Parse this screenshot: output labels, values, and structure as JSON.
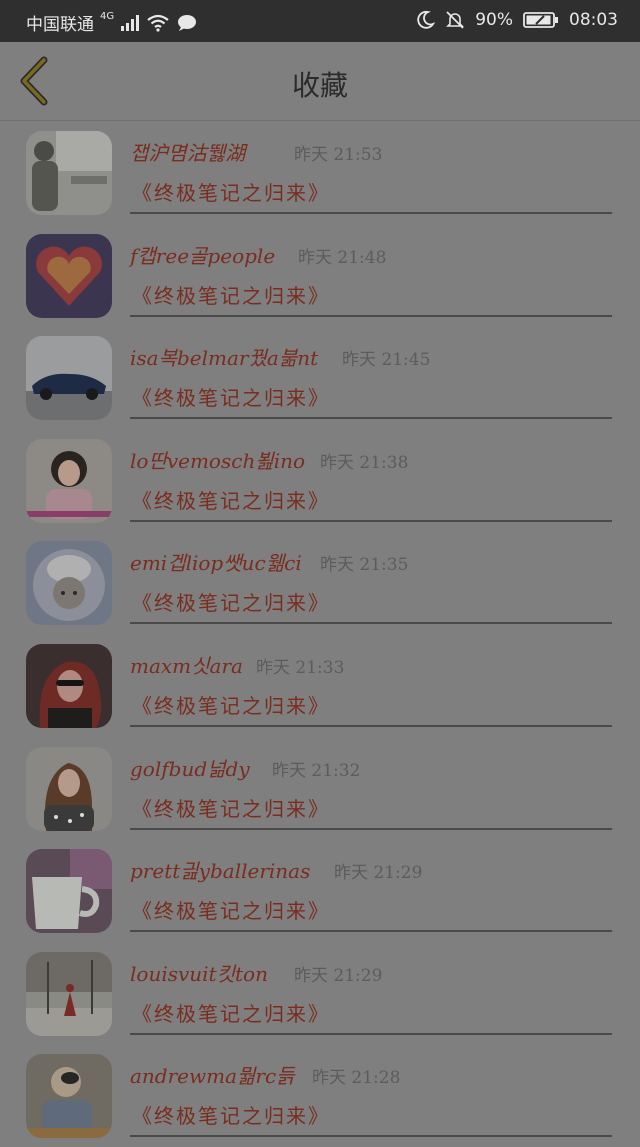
{
  "status_bar": {
    "carrier": "中国联通",
    "network": "4G",
    "battery": "90%",
    "time": "08:03"
  },
  "header": {
    "back_icon": "chevron-left-icon",
    "title": "收藏"
  },
  "items": [
    {
      "name": "잽沪몀沽뛣湖",
      "time": "昨天 21:53",
      "book": "《终极笔记之归来》"
    },
    {
      "name": "f캡ree골people",
      "time": "昨天 21:48",
      "book": "《终极笔记之归来》"
    },
    {
      "name": "isa복belmar꿨a붊nt",
      "time": "昨天 21:45",
      "book": "《终极笔记之归来》"
    },
    {
      "name": "lo딴vemosch뵖ino",
      "time": "昨天 21:38",
      "book": "《终极笔记之归来》"
    },
    {
      "name": "emi겝liop쌧uc웲ci",
      "time": "昨天 21:35",
      "book": "《终极笔记之归来》"
    },
    {
      "name": "maxm싯ara",
      "time": "昨天 21:33",
      "book": "《终极笔记之归来》"
    },
    {
      "name": "golfbud넒dy",
      "time": "昨天 21:32",
      "book": "《终极笔记之归来》"
    },
    {
      "name": "prett긢yballerinas",
      "time": "昨天 21:29",
      "book": "《终极笔记之归来》"
    },
    {
      "name": "louisvuit킷ton",
      "time": "昨天 21:29",
      "book": "《终极笔记之归来》"
    },
    {
      "name": "andrewma뭚rc듥",
      "time": "昨天 21:28",
      "book": "《终极笔记之归来》"
    }
  ]
}
